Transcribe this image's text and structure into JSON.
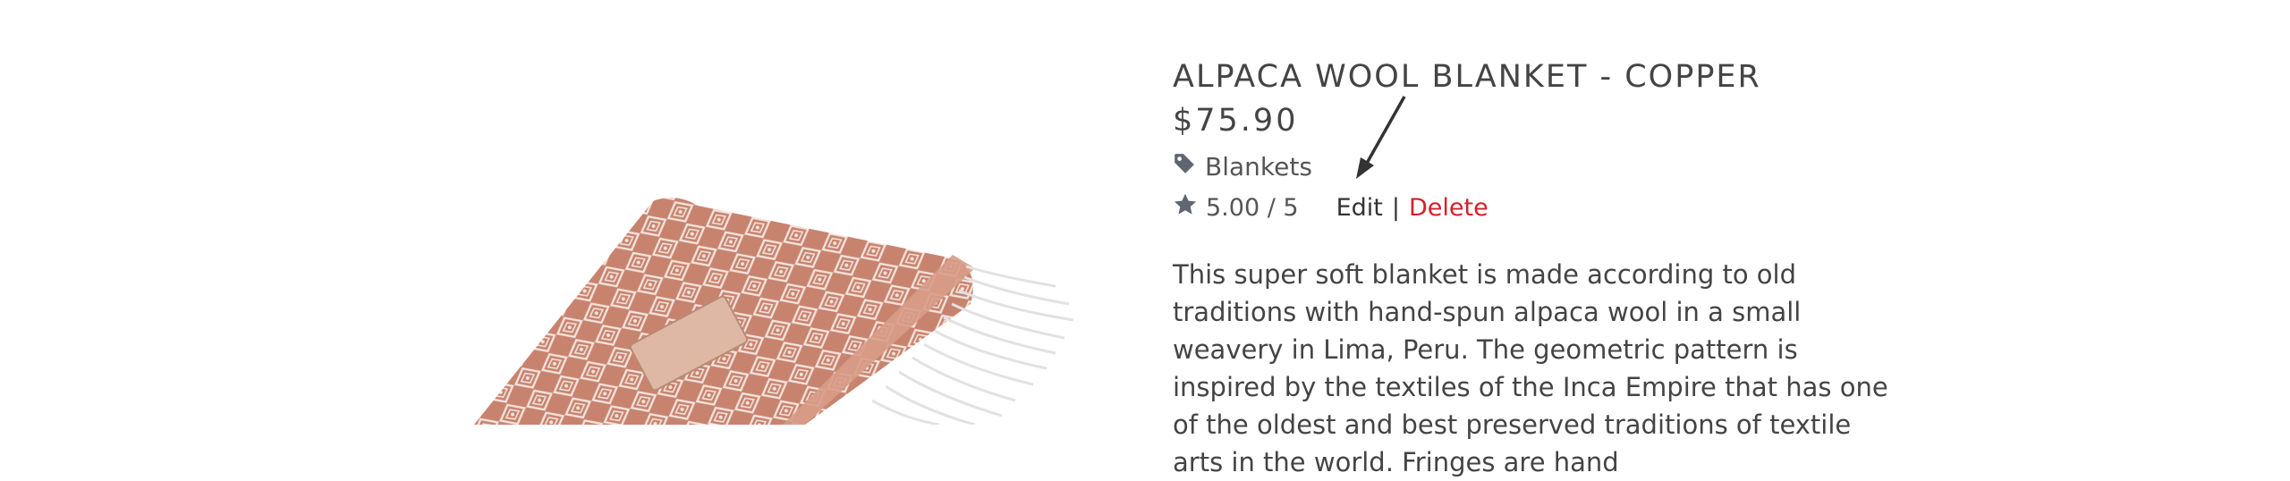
{
  "product": {
    "title": "ALPACA WOOL BLANKET - COPPER",
    "price": "$75.90",
    "category": "Blankets",
    "rating": "5.00 / 5",
    "description": "This super soft blanket is made according to old traditions with hand-spun alpaca wool in a small weavery in Lima, Peru. The geometric pattern is inspired by the textiles of the Inca Empire that has one of the oldest and best preserved traditions of textile arts in the world. Fringes are hand"
  },
  "actions": {
    "edit_label": "Edit",
    "separator": "|",
    "delete_label": "Delete"
  },
  "icons": {
    "category": "tag-icon",
    "rating": "star-icon"
  },
  "colors": {
    "delete": "#d4202a",
    "blanket": "#c8836f"
  }
}
